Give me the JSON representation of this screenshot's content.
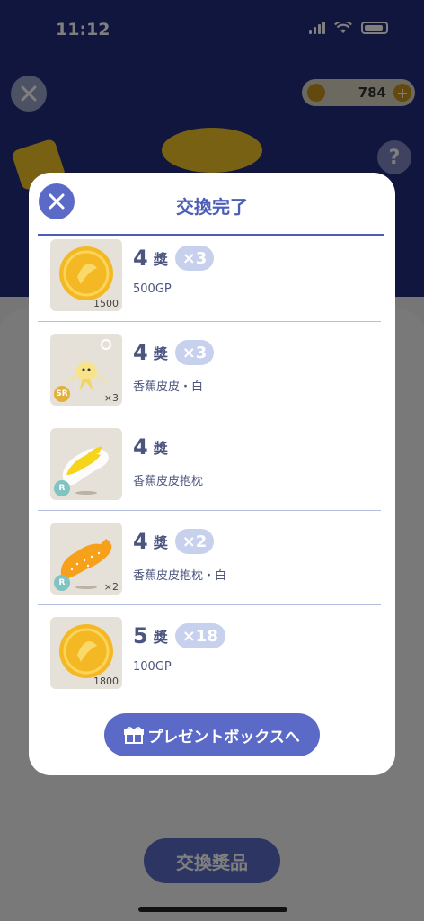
{
  "status": {
    "time": "11:12"
  },
  "background": {
    "coin_balance": "784",
    "coin_plus": "+",
    "help": "?",
    "exchange_button": "交換獎品"
  },
  "modal": {
    "title": "交換完了",
    "items": [
      {
        "rank": "4",
        "unit": "獎",
        "multiplier": "×3",
        "name": "500GP",
        "qty": "1500",
        "rarity": "",
        "kind": "coin"
      },
      {
        "rank": "4",
        "unit": "獎",
        "multiplier": "×3",
        "name": "香蕉皮皮・白",
        "qty": "×3",
        "rarity": "SR",
        "kind": "figure-white"
      },
      {
        "rank": "4",
        "unit": "獎",
        "multiplier": "",
        "name": "香蕉皮皮抱枕",
        "qty": "",
        "rarity": "R",
        "kind": "pillow-yellow"
      },
      {
        "rank": "4",
        "unit": "獎",
        "multiplier": "×2",
        "name": "香蕉皮皮抱枕・白",
        "qty": "×2",
        "rarity": "R",
        "kind": "pillow-orange"
      },
      {
        "rank": "5",
        "unit": "獎",
        "multiplier": "×18",
        "name": "100GP",
        "qty": "1800",
        "rarity": "",
        "kind": "coin"
      }
    ],
    "present_button": "プレゼントボックスへ"
  },
  "colors": {
    "accent": "#5b6ac7",
    "title": "#4c5db8",
    "text": "#4c5580",
    "multiplier_bg": "#c7d1ee",
    "background_dark": "#222c7c"
  },
  "icons": {
    "close": "close-icon",
    "gift": "gift-icon",
    "coin": "gp-coin-icon"
  }
}
